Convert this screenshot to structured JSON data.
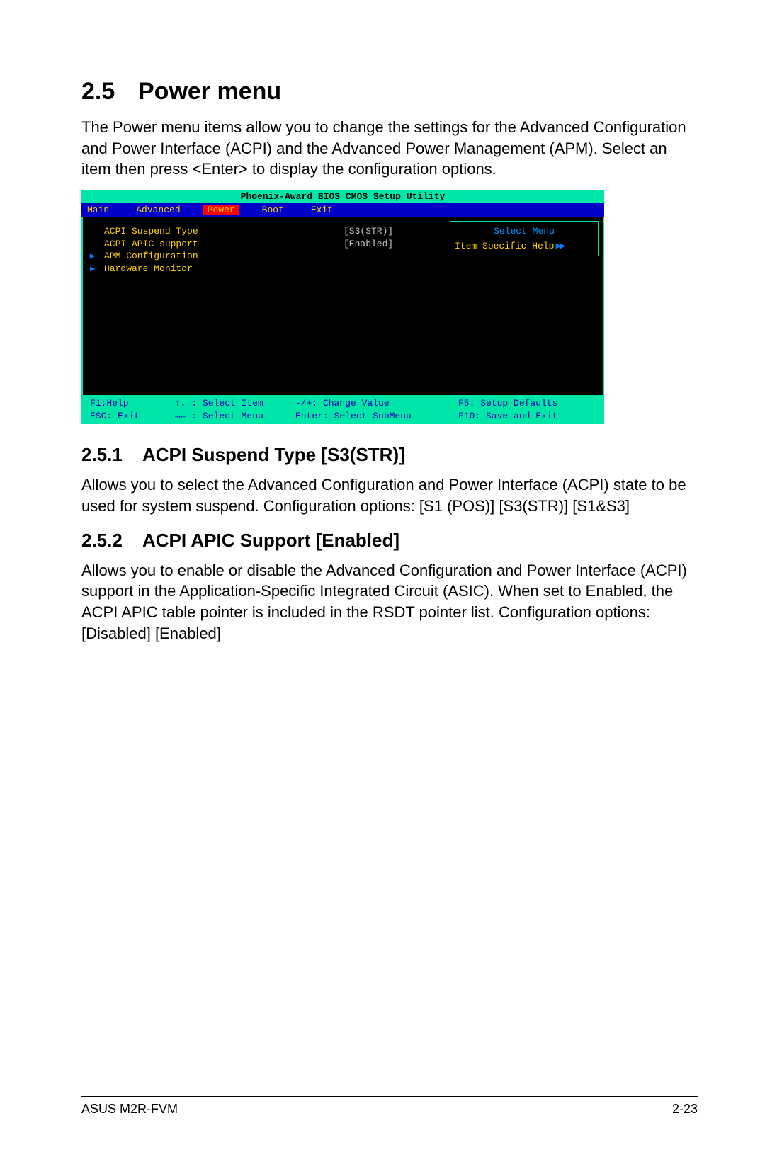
{
  "heading": {
    "num": "2.5",
    "title": "Power menu"
  },
  "intro": "The Power menu items allow you to change the settings for the Advanced Configuration and Power Interface (ACPI) and the Advanced Power Management (APM). Select an item then press <Enter> to display the configuration options.",
  "bios": {
    "title": "Phoenix-Award BIOS CMOS Setup Utility",
    "tabs": [
      "Main",
      "Advanced",
      "Power",
      "Boot",
      "Exit"
    ],
    "active_tab": "Power",
    "items": [
      {
        "arrow": "",
        "label": "ACPI Suspend Type",
        "value": "[S3(STR)]"
      },
      {
        "arrow": "",
        "label": "ACPI APIC support",
        "value": "[Enabled]"
      },
      {
        "arrow": "▶",
        "label": "APM Configuration",
        "value": ""
      },
      {
        "arrow": "▶",
        "label": "Hardware Monitor",
        "value": ""
      }
    ],
    "right": {
      "title": "Select Menu",
      "help": "Item Specific Help"
    },
    "footer": {
      "c1a": "F1:Help",
      "c2a": "↑↓ : Select Item",
      "c3a": "-/+: Change Value",
      "c4a": "F5: Setup Defaults",
      "c1b": "ESC: Exit",
      "c2b": "→← : Select Menu",
      "c3b": "Enter: Select SubMenu",
      "c4b": "F10: Save and Exit"
    }
  },
  "s251": {
    "num": "2.5.1",
    "title": "ACPI Suspend Type [S3(STR)]",
    "body": "Allows you to select the Advanced Configuration and Power Interface (ACPI) state to be used for system suspend. Configuration options: [S1 (POS)] [S3(STR)] [S1&S3]"
  },
  "s252": {
    "num": "2.5.2",
    "title": "ACPI APIC Support [Enabled]",
    "body": "Allows you to enable or disable the Advanced Configuration and Power Interface (ACPI) support in the Application-Specific Integrated Circuit (ASIC). When set to Enabled, the ACPI APIC table pointer is included in the RSDT pointer list. Configuration options: [Disabled] [Enabled]"
  },
  "footer": {
    "left": "ASUS M2R-FVM",
    "right": "2-23"
  }
}
